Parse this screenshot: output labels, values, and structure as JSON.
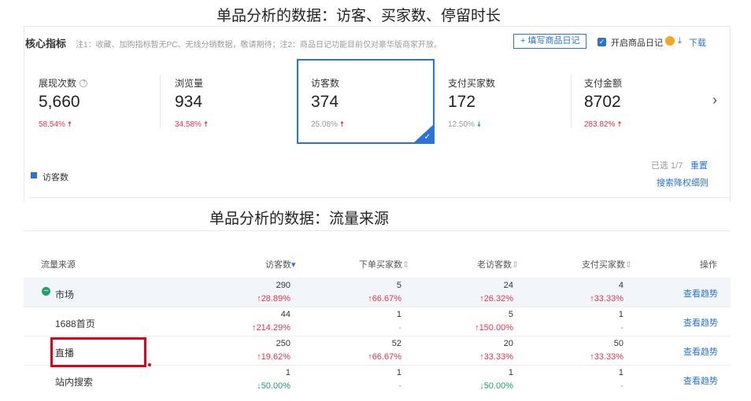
{
  "title_top": "单品分析的数据：访客、买家数、停留时长",
  "title_mid": "单品分析的数据：流量来源",
  "header": {
    "section_title": "核心指标",
    "note": "注1：收藏、加购指标暂无PC、无线分销数据，敬请期待；注2：商品日记功能目前仅对豪华版商家开放。",
    "diary_button": "+ 填写商品日记",
    "enable_diary_label": "开启商品日记",
    "download_label": "下载"
  },
  "metrics": [
    {
      "label": "展现次数",
      "value": "5,660",
      "change": "58.54%",
      "direction": "up"
    },
    {
      "label": "浏览量",
      "value": "934",
      "change": "34.58%",
      "direction": "up"
    },
    {
      "label": "访客数",
      "value": "374",
      "change": "25.08%",
      "direction": "up",
      "selected": true
    },
    {
      "label": "支付买家数",
      "value": "172",
      "change": "12.50%",
      "direction": "down"
    },
    {
      "label": "支付金额",
      "value": "8702",
      "change": "283.82%",
      "direction": "up"
    }
  ],
  "legend_label": "访客数",
  "selected_info": "已选 1/7",
  "reset_label": "重置",
  "search_rank_label": "搜索降权细则",
  "table": {
    "headers": [
      "流量来源",
      "访客数",
      "下单买家数",
      "老访客数",
      "支付买家数",
      "操作"
    ],
    "rows": [
      {
        "name": "市场",
        "cells": [
          [
            "290",
            "↑28.89%"
          ],
          [
            "5",
            "↑66.67%"
          ],
          [
            "24",
            "↑26.32%"
          ],
          [
            "4",
            "↑33.33%"
          ]
        ],
        "action": "查看趋势"
      },
      {
        "name": "1688首页",
        "cells": [
          [
            "44",
            "↑214.29%"
          ],
          [
            "1",
            "-"
          ],
          [
            "5",
            "↑150.00%"
          ],
          [
            "1",
            "-"
          ]
        ],
        "action": "查看趋势"
      },
      {
        "name": "直播",
        "cells": [
          [
            "250",
            "↑19.62%"
          ],
          [
            "52",
            "↑66.67%"
          ],
          [
            "20",
            "↑33.33%"
          ],
          [
            "50",
            "↑33.33%"
          ]
        ],
        "action": "查看趋势"
      },
      {
        "name": "站内搜索",
        "cells": [
          [
            "1",
            "↓50.00%"
          ],
          [
            "1",
            "-"
          ],
          [
            "1",
            "↓50.00%"
          ],
          [
            "1",
            "-"
          ]
        ],
        "action": "查看趋势"
      }
    ]
  },
  "colors": {
    "accent": "#2a73d9",
    "up": "#e0364c",
    "down": "#22a06b",
    "highlight_box": "#e3001b"
  }
}
